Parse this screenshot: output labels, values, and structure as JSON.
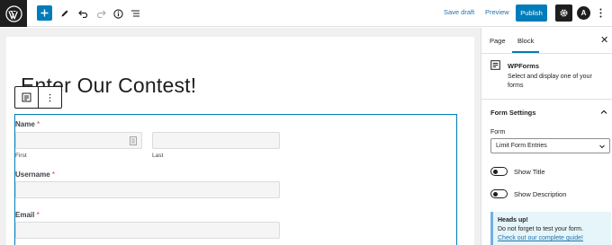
{
  "toolbar": {
    "save_draft": "Save draft",
    "preview": "Preview",
    "publish": "Publish",
    "astra_letter": "A",
    "accent": "#007cba"
  },
  "editor": {
    "title": "Enter Our Contest!",
    "form": {
      "name_label": "Name",
      "required_mark": "*",
      "first_sublabel": "First",
      "last_sublabel": "Last",
      "username_label": "Username",
      "email_label": "Email"
    }
  },
  "sidebar": {
    "tabs": [
      "Page",
      "Block"
    ],
    "active_tab": "Block",
    "block_name": "WPForms",
    "block_desc": "Select and display one of your forms",
    "form_settings_title": "Form Settings",
    "form_label": "Form",
    "form_selected": "Limit Form Entries",
    "show_title_label": "Show Title",
    "show_description_label": "Show Description",
    "notice": {
      "title": "Heads up!",
      "text": "Do not forget to test your form.",
      "link": "Check out our complete guide!"
    }
  }
}
